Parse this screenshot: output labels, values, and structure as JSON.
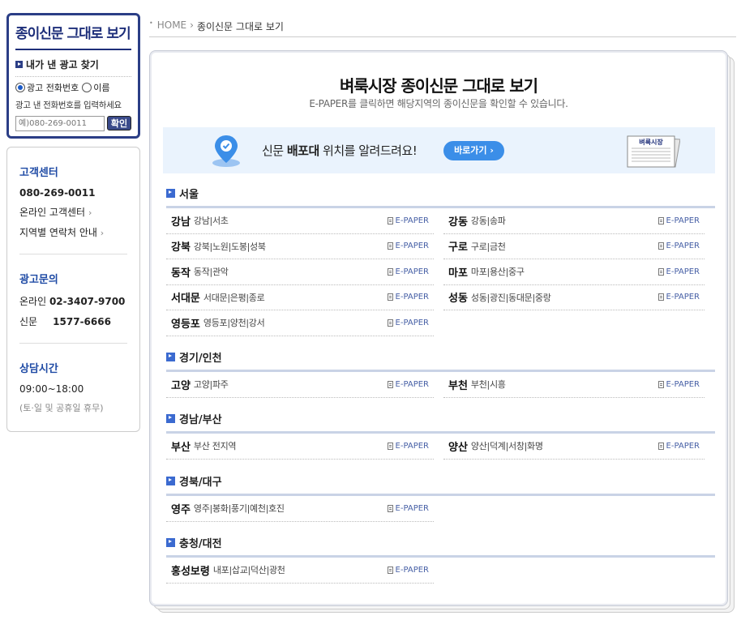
{
  "search": {
    "title": "종이신문 그대로 보기",
    "subtitle": "내가 낸 광고 찾기",
    "radio_phone": "광고 전화번호",
    "radio_name": "이름",
    "hint": "광고 낸 전화번호를 입력하세요",
    "placeholder": "예)080-269-0011",
    "submit": "확인"
  },
  "info": {
    "cs_title": "고객센터",
    "cs_phone": "080-269-0011",
    "cs_online": "온라인 고객센터",
    "cs_region": "지역별 연락처 안내",
    "ad_title": "광고문의",
    "ad_online_label": "온라인",
    "ad_online_phone": "02-3407-9700",
    "ad_paper_label": "신문",
    "ad_paper_phone": "1577-6666",
    "hours_title": "상담시간",
    "hours": "09:00~18:00",
    "hours_note": "(토·일 및 공휴일 휴무)"
  },
  "breadcrumb": {
    "home": "HOME",
    "current": "종이신문 그대로 보기"
  },
  "main": {
    "title": "벼룩시장 종이신문 그대로 보기",
    "desc": "E-PAPER를 클릭하면 해당지역의 종이신문을 확인할 수 있습니다.",
    "banner_pre": "신문 ",
    "banner_bold": "배포대",
    "banner_post": " 위치를 알려드려요!",
    "banner_button": "바로가기",
    "paper_label": "벼룩시장",
    "epaper_label": "E-PAPER"
  },
  "regions": [
    {
      "name": "서울",
      "items": [
        {
          "name": "강남",
          "desc": "강남|서초"
        },
        {
          "name": "강동",
          "desc": "강동|송파"
        },
        {
          "name": "강북",
          "desc": "강북|노원|도봉|성북"
        },
        {
          "name": "구로",
          "desc": "구로|금천"
        },
        {
          "name": "동작",
          "desc": "동작|관악"
        },
        {
          "name": "마포",
          "desc": "마포|용산|중구"
        },
        {
          "name": "서대문",
          "desc": "서대문|은평|종로"
        },
        {
          "name": "성동",
          "desc": "성동|광진|동대문|중랑"
        },
        {
          "name": "영등포",
          "desc": "영등포|양천|강서"
        }
      ]
    },
    {
      "name": "경기/인천",
      "items": [
        {
          "name": "고양",
          "desc": "고양|파주"
        },
        {
          "name": "부천",
          "desc": "부천|시흥"
        }
      ]
    },
    {
      "name": "경남/부산",
      "items": [
        {
          "name": "부산",
          "desc": "부산 전지역"
        },
        {
          "name": "양산",
          "desc": "양산|덕계|서창|화명"
        }
      ]
    },
    {
      "name": "경북/대구",
      "items": [
        {
          "name": "영주",
          "desc": "영주|봉화|풍기|예천|호진"
        }
      ]
    },
    {
      "name": "충청/대전",
      "items": [
        {
          "name": "홍성보령",
          "desc": "내포|삽교|덕산|광천"
        }
      ]
    }
  ],
  "colors": {
    "brand": "#2b3e86",
    "accent": "#3b8ee8",
    "banner_bg": "#eaf3fd"
  }
}
